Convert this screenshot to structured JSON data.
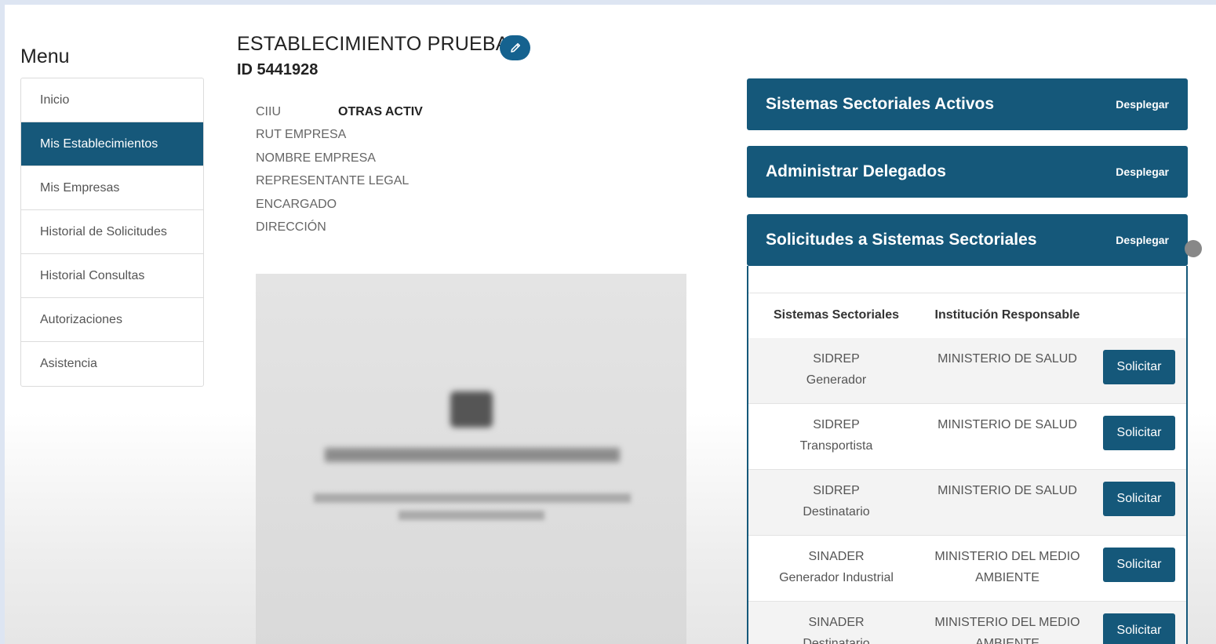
{
  "sidebar": {
    "title": "Menu",
    "items": [
      {
        "label": "Inicio"
      },
      {
        "label": "Mis Establecimientos"
      },
      {
        "label": "Mis Empresas"
      },
      {
        "label": "Historial de Solicitudes"
      },
      {
        "label": "Historial Consultas"
      },
      {
        "label": "Autorizaciones"
      },
      {
        "label": "Asistencia"
      }
    ],
    "active_item": "Mis Establecimientos"
  },
  "establishment": {
    "title": "ESTABLECIMIENTO PRUEBA",
    "id_text": "ID 5441928",
    "edit_icon": "pencil-icon",
    "fields": [
      {
        "label": "CIIU",
        "value": "OTRAS ACTIV"
      },
      {
        "label": "RUT EMPRESA",
        "value": ""
      },
      {
        "label": "NOMBRE EMPRESA",
        "value": ""
      },
      {
        "label": "REPRESENTANTE LEGAL",
        "value": ""
      },
      {
        "label": "ENCARGADO",
        "value": ""
      },
      {
        "label": "DIRECCIÓN",
        "value": ""
      }
    ]
  },
  "panels": [
    {
      "title": "Sistemas Sectoriales Activos",
      "toggle": "Desplegar"
    },
    {
      "title": "Administrar Delegados",
      "toggle": "Desplegar"
    },
    {
      "title": "Solicitudes a Sistemas Sectoriales",
      "toggle": "Desplegar"
    }
  ],
  "requests_table": {
    "headers": [
      "Sistemas Sectoriales",
      "Institución Responsable"
    ],
    "rows": [
      {
        "system": "SIDREP",
        "subtype": "Generador",
        "inst1": "MINISTERIO DE SALUD",
        "inst2": "",
        "action": "Solicitar"
      },
      {
        "system": "SIDREP",
        "subtype": "Transportista",
        "inst1": "MINISTERIO DE SALUD",
        "inst2": "",
        "action": "Solicitar"
      },
      {
        "system": "SIDREP",
        "subtype": "Destinatario",
        "inst1": "MINISTERIO DE SALUD",
        "inst2": "",
        "action": "Solicitar"
      },
      {
        "system": "SINADER",
        "subtype": "Generador Industrial",
        "inst1": "MINISTERIO DEL MEDIO",
        "inst2": "AMBIENTE",
        "action": "Solicitar"
      },
      {
        "system": "SINADER",
        "subtype": "Destinatario",
        "inst1": "MINISTERIO DEL MEDIO",
        "inst2": "AMBIENTE",
        "action": "Solicitar"
      }
    ]
  },
  "colors": {
    "primary": "#15587a",
    "edit_button": "#15628f",
    "row_alt": "#f3f3f3"
  }
}
